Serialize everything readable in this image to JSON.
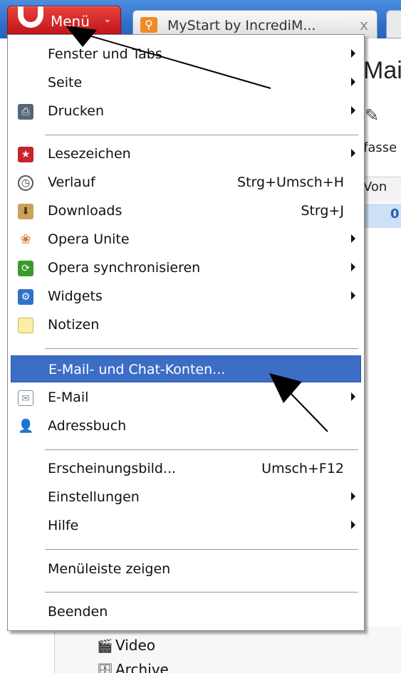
{
  "browser": {
    "menu_button_label": "Menü",
    "tab_title": "MyStart by IncrediM...",
    "tab_close": "x"
  },
  "background": {
    "heading": "Mai",
    "fasse": "fasse",
    "von": "Von",
    "zero": "0",
    "sidebar_items": [
      {
        "label": "Video",
        "icon": "video-icon"
      },
      {
        "label": "Archive",
        "icon": "archive-icon"
      }
    ]
  },
  "menu": {
    "items": [
      {
        "label": "Fenster und Tabs",
        "icon": null,
        "submenu": true,
        "shortcut": ""
      },
      {
        "label": "Seite",
        "icon": null,
        "submenu": true,
        "shortcut": ""
      },
      {
        "label": "Drucken",
        "icon": "printer-icon",
        "submenu": true,
        "shortcut": ""
      },
      {
        "label": "Lesezeichen",
        "icon": "bookmark-icon",
        "submenu": true,
        "shortcut": ""
      },
      {
        "label": "Verlauf",
        "icon": "history-icon",
        "submenu": false,
        "shortcut": "Strg+Umsch+H"
      },
      {
        "label": "Downloads",
        "icon": "download-icon",
        "submenu": false,
        "shortcut": "Strg+J"
      },
      {
        "label": "Opera Unite",
        "icon": "unite-icon",
        "submenu": true,
        "shortcut": ""
      },
      {
        "label": "Opera synchronisieren",
        "icon": "sync-icon",
        "submenu": true,
        "shortcut": ""
      },
      {
        "label": "Widgets",
        "icon": "widget-icon",
        "submenu": true,
        "shortcut": ""
      },
      {
        "label": "Notizen",
        "icon": "notes-icon",
        "submenu": false,
        "shortcut": ""
      },
      {
        "label": "E-Mail- und Chat-Konten...",
        "icon": null,
        "submenu": false,
        "shortcut": "",
        "selected": true
      },
      {
        "label": "E-Mail",
        "icon": "mail-icon",
        "submenu": true,
        "shortcut": ""
      },
      {
        "label": "Adressbuch",
        "icon": "addressbook-icon",
        "submenu": false,
        "shortcut": ""
      },
      {
        "label": "Erscheinungsbild...",
        "icon": null,
        "submenu": false,
        "shortcut": "Umsch+F12"
      },
      {
        "label": "Einstellungen",
        "icon": null,
        "submenu": true,
        "shortcut": ""
      },
      {
        "label": "Hilfe",
        "icon": null,
        "submenu": true,
        "shortcut": ""
      },
      {
        "label": "Menüleiste zeigen",
        "icon": null,
        "submenu": false,
        "shortcut": ""
      },
      {
        "label": "Beenden",
        "icon": null,
        "submenu": false,
        "shortcut": ""
      }
    ]
  },
  "colors": {
    "highlight": "#3d6ec6",
    "opera_red": "#c3161c",
    "tabbar_blue": "#2f6fcb"
  }
}
